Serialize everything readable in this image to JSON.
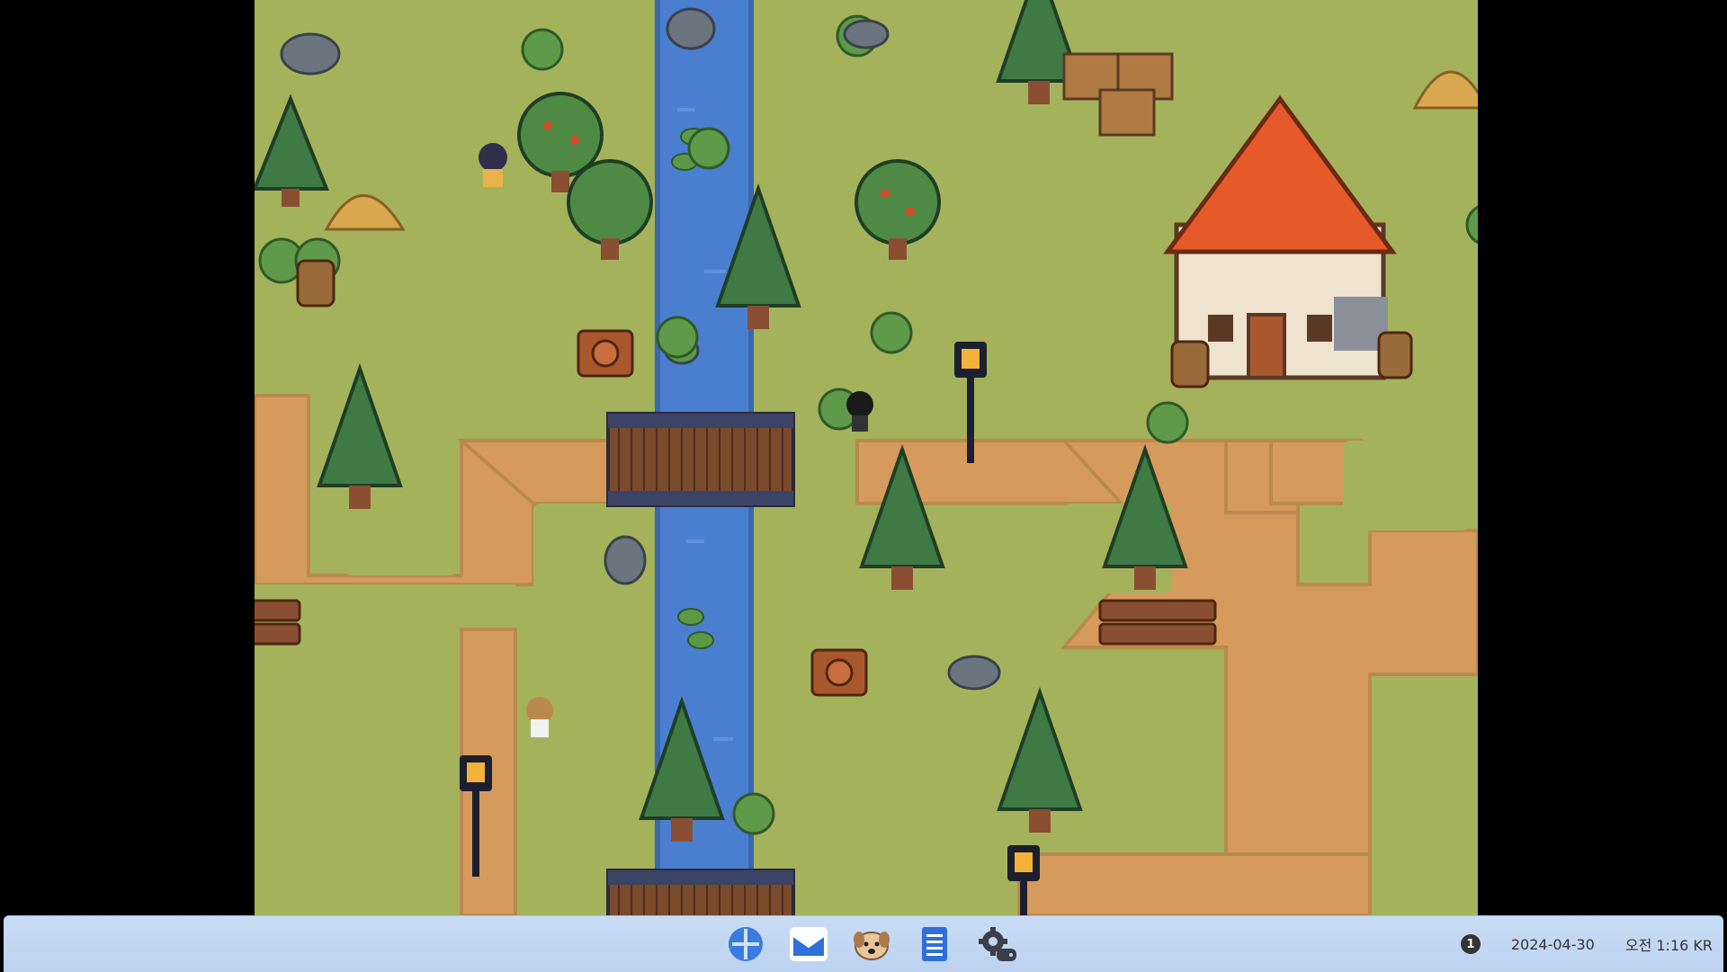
{
  "game": {
    "scene": "pixel-art village with river, bridges, trees, lamp posts, farmhouse"
  },
  "taskbar": {
    "apps": [
      {
        "name": "start-menu",
        "icon": "grid-icon"
      },
      {
        "name": "mail",
        "icon": "mail-icon"
      },
      {
        "name": "pet",
        "icon": "dog-face-icon"
      },
      {
        "name": "notes",
        "icon": "notepad-icon"
      },
      {
        "name": "settings",
        "icon": "gear-gamepad-icon"
      }
    ],
    "notification_count": "1",
    "date": "2024-04-30",
    "time": "오전 1:16 KR"
  },
  "colors": {
    "grass": "#a3b35a",
    "dirt": "#d69a5c",
    "water": "#4c7fd0",
    "taskbar": "#c4d8f3"
  }
}
